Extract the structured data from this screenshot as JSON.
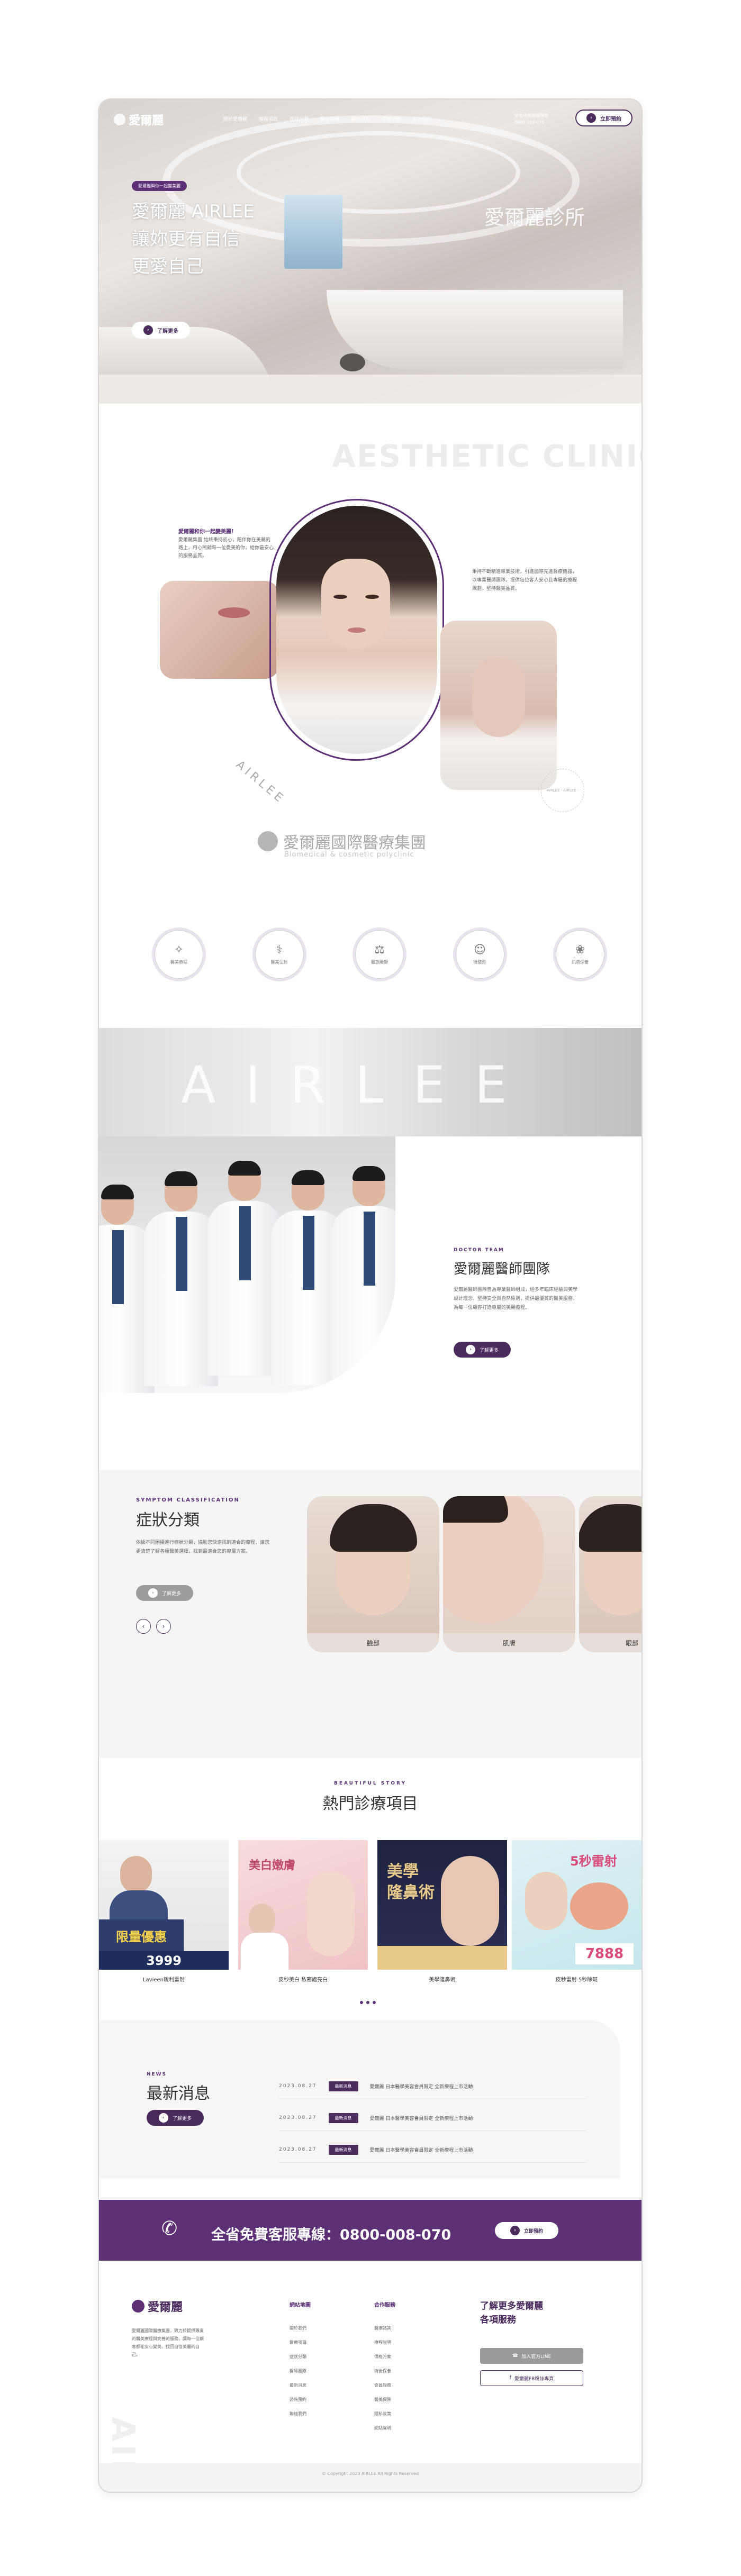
{
  "nav": {
    "logo": "愛爾麗",
    "menu": [
      "關於愛爾麗",
      "療程項目",
      "症狀分類",
      "醫師團隊",
      "最新消息",
      "優惠活動",
      "諮詢預約"
    ],
    "phone_label": "全省免費客服專線",
    "phone": "0800-008-070",
    "book_label": "立即預約"
  },
  "hero": {
    "badge": "愛爾麗與你一起變美麗",
    "title_line1": "愛爾麗 AIRLEE",
    "title_line2": "讓妳更有自信",
    "title_line3": "更愛自己",
    "sign": "愛爾麗診所",
    "more_label": "了解更多"
  },
  "about": {
    "ghost": "AESTHETIC CLINIC",
    "tag": "愛爾麗和你一起變美麗！",
    "text": "愛爾麗集團 始終秉持初心，陪伴你在美麗的路上，用心照顧每一位愛美的你，給你最安心的服務品質。",
    "text2": "秉持不斷精進專業技術，引進國際先進醫療儀器，以專業醫師團隊，提供每位客人安心且專屬的療程規劃，堅持醫美品質。",
    "rotated": "AIRLEE",
    "ring": "AIRLEE · AIRLEE ·",
    "group_name": "愛爾麗國際醫療集團",
    "group_sub": "Biomedical & cosmetic polyclinic"
  },
  "services": [
    {
      "icon": "sparkle-icon",
      "glyph": "✧",
      "label": "醫美療程"
    },
    {
      "icon": "syringe-icon",
      "glyph": "⚕",
      "label": "醫美注射"
    },
    {
      "icon": "scale-icon",
      "glyph": "⚖",
      "label": "體態雕塑"
    },
    {
      "icon": "tooth-icon",
      "glyph": "☺",
      "label": "微整形"
    },
    {
      "icon": "leaf-icon",
      "glyph": "❀",
      "label": "肌膚保養"
    }
  ],
  "band": {
    "text": "AIRLEE"
  },
  "team": {
    "tag": "DOCTOR TEAM",
    "title": "愛爾麗醫師團隊",
    "text": "愛爾麗醫師團隊皆為專業醫師組成，經多年臨床經驗與美學設計理念，堅持安全與自然原則，提供最優質的醫美服務，為每一位顧客打造專屬的美麗療程。",
    "btn": "了解更多"
  },
  "symptom": {
    "tag": "SYMPTOM CLASSIFICATION",
    "title": "症狀分類",
    "text": "依據不同困擾進行症狀分類，協助您快速找到適合的療程，讓您更清楚了解各種醫美選擇，找到最適合您的專屬方案。",
    "btn": "了解更多",
    "prev": "‹",
    "next": "›",
    "cards": [
      "臉部",
      "肌膚",
      "眼部"
    ]
  },
  "popular": {
    "tag": "BEAUTIFUL STORY",
    "title": "熱門診療項目",
    "items": [
      {
        "label": "Lavieen銳利雷射",
        "promo": "限量優惠",
        "price": "3999"
      },
      {
        "label": "皮秒美白 私密處亮白",
        "promo": "美白嫩膚",
        "price": ""
      },
      {
        "label": "美學隆鼻術",
        "promo": "美學 隆鼻術",
        "price": ""
      },
      {
        "label": "皮秒雷射 5秒除斑",
        "promo": "5秒雷射",
        "price": "7888"
      }
    ]
  },
  "news": {
    "tag": "NEWS",
    "title": "最新消息",
    "btn": "了解更多",
    "rows": [
      {
        "date": "2023.08.27",
        "badge": "最新消息",
        "title": "愛爾麗 日本醫學美容會員限定 全新療程上市活動"
      },
      {
        "date": "2023.08.27",
        "badge": "最新消息",
        "title": "愛爾麗 日本醫學美容會員限定 全新療程上市活動"
      },
      {
        "date": "2023.08.27",
        "badge": "最新消息",
        "title": "愛爾麗 日本醫學美容會員限定 全新療程上市活動"
      }
    ]
  },
  "hotline": {
    "text": "全省免費客服專線：0800-008-070",
    "btn": "立即預約"
  },
  "footer": {
    "logo": "愛爾麗",
    "desc": "愛爾麗國際醫療集團，致力於提供專業的醫美療程與完善的服務，讓每一位顧客都能安心變美，找回自信美麗的自己。",
    "vertical": "AIRLEE",
    "col1_title": "網站地圖",
    "col1_items": [
      "關於我們",
      "醫療項目",
      "症狀分類",
      "醫師團隊",
      "最新消息",
      "諮詢預約",
      "聯絡我們"
    ],
    "col2_title": "合作服務",
    "col2_items": [
      "醫療諮詢",
      "療程說明",
      "價格方案",
      "術後保養",
      "會員服務",
      "醫美保險",
      "隱私政策",
      "網站聲明"
    ],
    "right_title_1": "了解更多愛爾麗",
    "right_title_2": "各項服務",
    "btn1": "加入官方LINE",
    "btn2": "愛爾麗FB粉絲專頁",
    "copyright": "© Copyright 2023 AIRLEE All Rights Reserved"
  },
  "colors": {
    "brand": "#5c2f77",
    "brand_dark": "#4b2a5e"
  }
}
